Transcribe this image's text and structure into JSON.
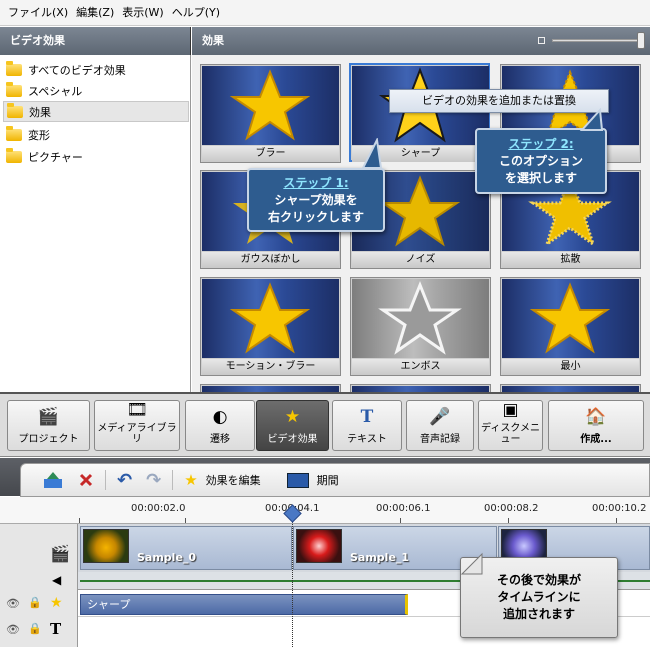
{
  "menubar": {
    "items": [
      "ファイル(X)",
      "編集(Z)",
      "表示(W)",
      "ヘルプ(Y)"
    ]
  },
  "sidebar": {
    "header": "ビデオ効果",
    "items": [
      {
        "label": "すべてのビデオ効果",
        "selected": false
      },
      {
        "label": "スペシャル",
        "selected": false
      },
      {
        "label": "効果",
        "selected": true
      },
      {
        "label": "変形",
        "selected": false
      },
      {
        "label": "ピクチャー",
        "selected": false
      }
    ]
  },
  "effects_panel": {
    "header": "効果",
    "tiles": [
      {
        "label": "ブラー"
      },
      {
        "label": "シャープ"
      },
      {
        "label": ""
      },
      {
        "label": "ガウスぼかし"
      },
      {
        "label": "ノイズ"
      },
      {
        "label": "拡散"
      },
      {
        "label": "モーション・ブラー"
      },
      {
        "label": "エンボス"
      },
      {
        "label": "最小"
      }
    ]
  },
  "context_menu": {
    "item": "ビデオの効果を追加または置換"
  },
  "callouts": {
    "step1_header": "ステップ 1:",
    "step1_line1": "シャープ効果を",
    "step1_line2": "右クリックします",
    "step2_header": "ステップ 2:",
    "step2_line1": "このオプション",
    "step2_line2": "を選択します",
    "after_line1": "その後で効果が",
    "after_line2": "タイムラインに",
    "after_line3": "追加されます"
  },
  "toolbar": {
    "buttons": [
      {
        "label": "プロジェクト",
        "active": false
      },
      {
        "label": "メディアライブラリ",
        "active": false
      },
      {
        "label": "遷移",
        "active": false
      },
      {
        "label": "ビデオ効果",
        "active": true
      },
      {
        "label": "テキスト",
        "active": false
      },
      {
        "label": "音声記録",
        "active": false
      },
      {
        "label": "ディスクメニュー",
        "active": false
      },
      {
        "label": "作成...",
        "active": false
      }
    ]
  },
  "timeline_toolbar": {
    "edit_effect": "効果を編集",
    "duration": "期間"
  },
  "ruler": {
    "labels": [
      "00:00:02.0",
      "00:00:04.1",
      "00:00:06.1",
      "00:00:08.2",
      "00:00:10.2"
    ]
  },
  "clips": [
    {
      "name": "Sample_0"
    },
    {
      "name": "Sample_1"
    }
  ],
  "effect_clip": {
    "name": "シャープ"
  },
  "colors": {
    "accent_blue": "#2e5c8f",
    "callout_header": "#8fe6ff",
    "star_gold": "#f7c600",
    "effect_marker": "#e8c400"
  }
}
